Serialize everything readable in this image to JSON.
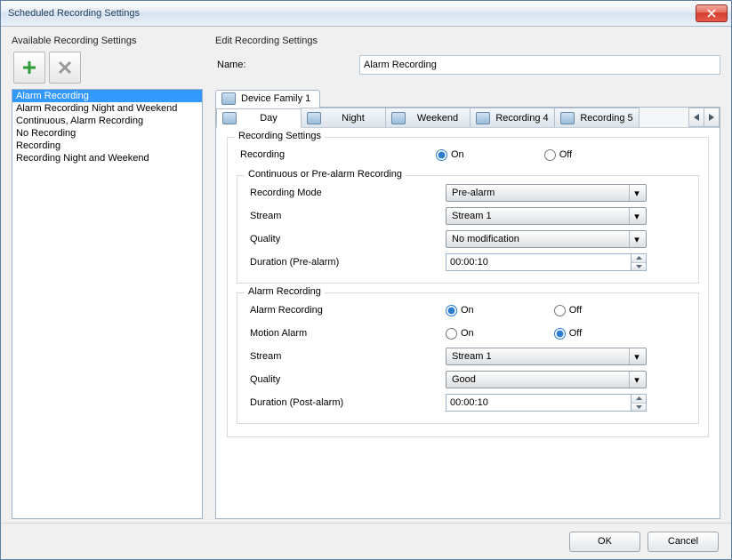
{
  "window": {
    "title": "Scheduled Recording Settings"
  },
  "left": {
    "label": "Available Recording Settings",
    "items": [
      "Alarm Recording",
      "Alarm Recording Night and Weekend",
      "Continuous, Alarm Recording",
      "No Recording",
      "Recording",
      "Recording Night and Weekend"
    ],
    "selected_index": 0
  },
  "edit": {
    "label": "Edit Recording Settings",
    "name_label": "Name:",
    "name_value": "Alarm Recording",
    "device_tab": "Device Family 1",
    "sched_tabs": [
      "Day",
      "Night",
      "Weekend",
      "Recording 4",
      "Recording 5"
    ],
    "sched_active": 0,
    "group_recording": "Recording Settings",
    "row_recording": "Recording",
    "on_label": "On",
    "off_label": "Off",
    "recording_value": "On",
    "group_cont": "Continuous or Pre-alarm Recording",
    "row_mode": "Recording Mode",
    "mode_value": "Pre-alarm",
    "row_stream": "Stream",
    "stream_value": "Stream 1",
    "row_quality": "Quality",
    "quality_value": "No modification",
    "row_duration_pre": "Duration (Pre-alarm)",
    "duration_pre_value": "00:00:10",
    "group_alarm": "Alarm Recording",
    "row_alarmrec": "Alarm Recording",
    "alarmrec_value": "On",
    "row_motion": "Motion Alarm",
    "motion_value": "Off",
    "row_stream2": "Stream",
    "stream2_value": "Stream 1",
    "row_quality2": "Quality",
    "quality2_value": "Good",
    "row_duration_post": "Duration (Post-alarm)",
    "duration_post_value": "00:00:10"
  },
  "footer": {
    "ok": "OK",
    "cancel": "Cancel"
  }
}
